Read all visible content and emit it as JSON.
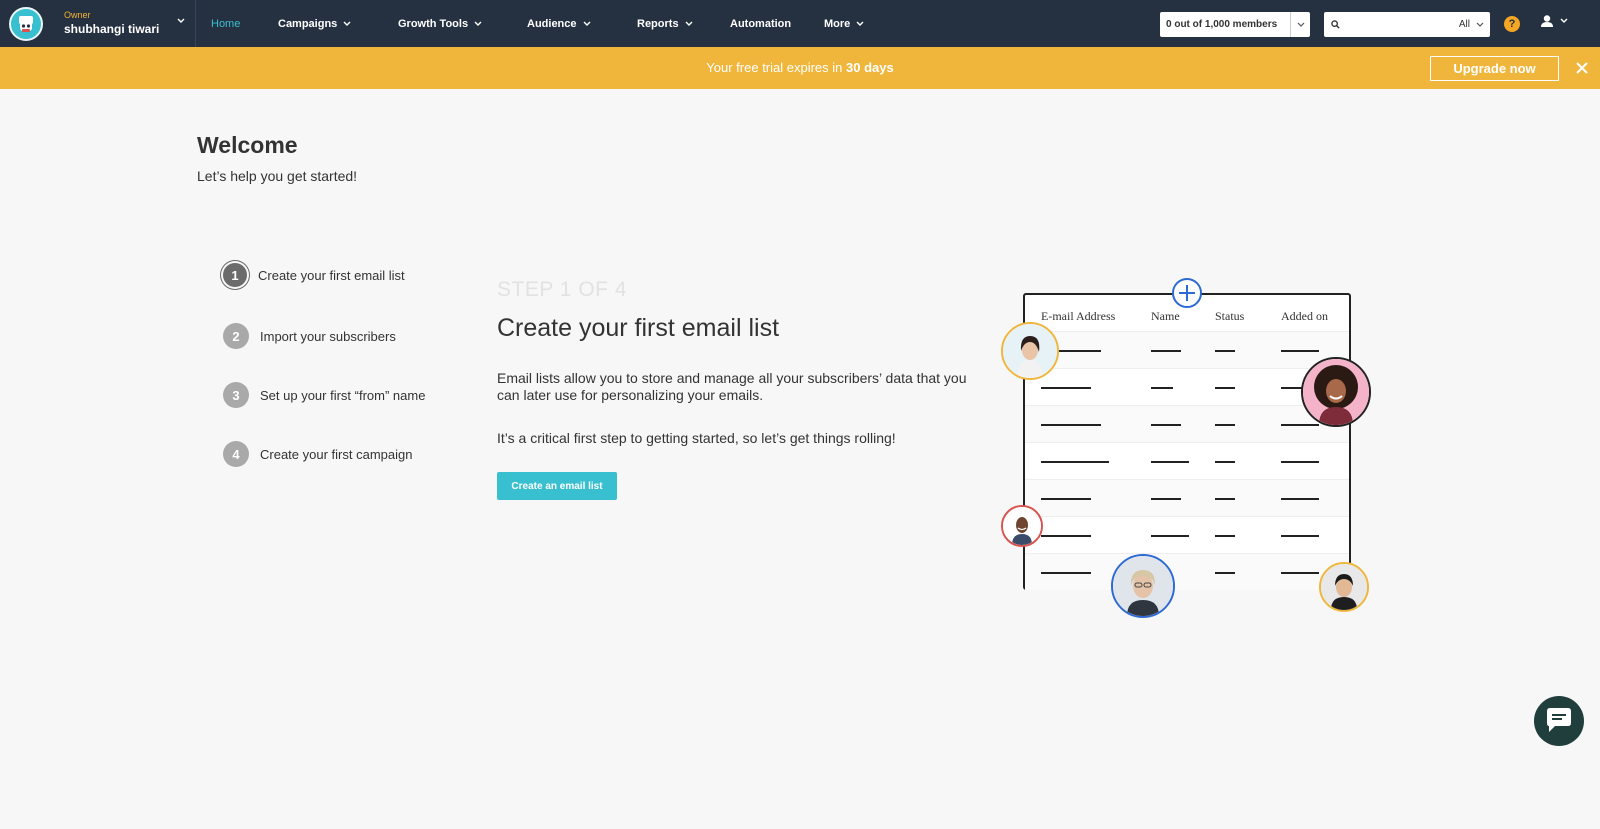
{
  "header": {
    "account": {
      "role": "Owner",
      "name": "shubhangi tiwari"
    },
    "nav": [
      {
        "label": "Home",
        "active": true,
        "dropdown": false
      },
      {
        "label": "Campaigns",
        "active": false,
        "dropdown": true
      },
      {
        "label": "Growth Tools",
        "active": false,
        "dropdown": true
      },
      {
        "label": "Audience",
        "active": false,
        "dropdown": true
      },
      {
        "label": "Reports",
        "active": false,
        "dropdown": true
      },
      {
        "label": "Automation",
        "active": false,
        "dropdown": false
      },
      {
        "label": "More",
        "active": false,
        "dropdown": true
      }
    ],
    "members": "0 out of 1,000 members",
    "search": {
      "value": "",
      "placeholder": "",
      "scope": "All"
    },
    "help_label": "?"
  },
  "banner": {
    "prefix": "Your free trial expires in ",
    "emphasis": "30 days",
    "upgrade_label": "Upgrade now"
  },
  "welcome": {
    "title": "Welcome",
    "subtitle": "Let’s help you get started!"
  },
  "steps": [
    {
      "num": "1",
      "label": "Create your first email list",
      "active": true
    },
    {
      "num": "2",
      "label": "Import your subscribers",
      "active": false
    },
    {
      "num": "3",
      "label": "Set up your first “from” name",
      "active": false
    },
    {
      "num": "4",
      "label": "Create your first campaign",
      "active": false
    }
  ],
  "content": {
    "step_of": "STEP 1 OF 4",
    "title": "Create your first email list",
    "paragraph1": "Email lists allow you to store and manage all your subscribers’ data that you can later use for personalizing your emails.",
    "paragraph2": "It’s a critical first step to getting started, so let’s get things rolling!",
    "cta_label": "Create an email list"
  },
  "illustration": {
    "columns": [
      "E-mail Address",
      "Name",
      "Status",
      "Added on"
    ]
  },
  "colors": {
    "nav_bg": "#253041",
    "accent": "#39c0d0",
    "banner": "#f0b63c",
    "help": "#f5a623",
    "chat": "#1f3e3c"
  }
}
